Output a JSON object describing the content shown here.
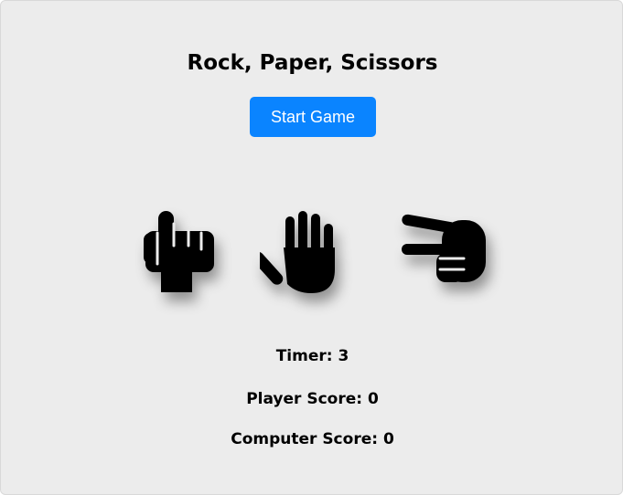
{
  "game": {
    "title": "Rock, Paper, Scissors",
    "start_label": "Start Game"
  },
  "choices": [
    {
      "name": "rock",
      "icon": "rock-hand-icon"
    },
    {
      "name": "paper",
      "icon": "paper-hand-icon"
    },
    {
      "name": "scissors",
      "icon": "scissors-hand-icon"
    }
  ],
  "stats": {
    "timer_text": "Timer: 3",
    "player_score_text": "Player Score: 0",
    "computer_score_text": "Computer Score: 0"
  },
  "colors": {
    "background": "#ececec",
    "button": "#0a84ff",
    "button_text": "#ffffff",
    "icon": "#000000"
  }
}
